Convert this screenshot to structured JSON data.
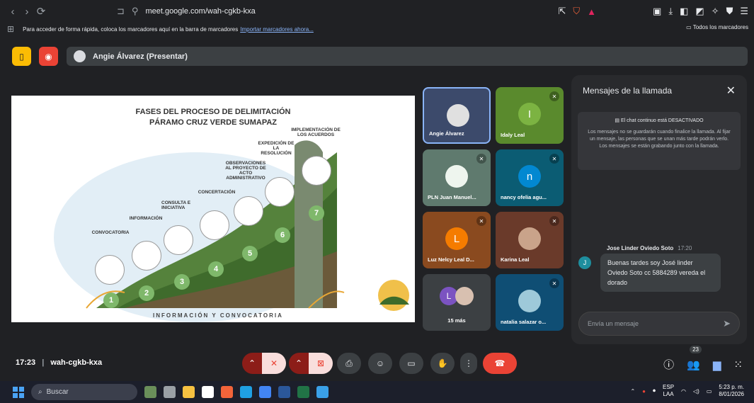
{
  "browser": {
    "url": "meet.google.com/wah-cgkb-kxa",
    "bookmarks_text": "Para acceder de forma rápida, coloca los marcadores aquí en la barra de marcadores",
    "bookmarks_link": "Importar marcadores ahora...",
    "all_bookmarks": "Todos los marcadores"
  },
  "meet": {
    "presenter_label": "Angie Álvarez (Presentar)",
    "meeting_time": "17:23",
    "meeting_code": "wah-cgkb-kxa",
    "participants_count": "23"
  },
  "slide": {
    "title_line1": "FASES DEL PROCESO DE DELIMITACIÓN",
    "title_line2": "PÁRAMO CRUZ VERDE SUMAPAZ",
    "footer": "INFORMACIÓN Y CONVOCATORIA",
    "steps": [
      {
        "num": "1",
        "label": "CONVOCATORIA"
      },
      {
        "num": "2",
        "label": "INFORMACIÓN"
      },
      {
        "num": "3",
        "label": "CONSULTA E INICIATIVA"
      },
      {
        "num": "4",
        "label": "CONCERTACIÓN"
      },
      {
        "num": "5",
        "label": "OBSERVACIONES AL PROYECTO DE ACTO ADMINISTRATIVO"
      },
      {
        "num": "6",
        "label": "EXPEDICIÓN DE LA RESOLUCIÓN"
      },
      {
        "num": "7",
        "label": "IMPLEMENTACIÓN DE LOS ACUERDOS"
      }
    ]
  },
  "participants": [
    {
      "name": "Angie Álvarez",
      "initial": "",
      "color": "#3c4a6b",
      "muted": false
    },
    {
      "name": "Idaly Leal",
      "initial": "I",
      "color": "#5a8a2d",
      "muted": true
    },
    {
      "name": "PLN Juan Manuel...",
      "initial": "",
      "color": "#5f7a6e",
      "muted": true
    },
    {
      "name": "nancy ofelia agu...",
      "initial": "n",
      "color": "#0b5c73",
      "muted": true
    },
    {
      "name": "Luz Nelcy Leal D...",
      "initial": "L",
      "color": "#8a4a1f",
      "muted": true
    },
    {
      "name": "Karina Leal",
      "initial": "",
      "color": "#6a3a2a",
      "muted": true
    },
    {
      "name": "15 más",
      "initial": "L",
      "color": "#3c4043",
      "muted": false
    },
    {
      "name": "natalia salazar o...",
      "initial": "",
      "color": "#0f4e74",
      "muted": true
    }
  ],
  "chat": {
    "title": "Mensajes de la llamada",
    "notice_heading": "El chat continuo está DESACTIVADO",
    "notice_body": "Los mensajes no se guardarán cuando finalice la llamada. Al fijar un mensaje, las personas que se unan más tarde podrán verlo. Los mensajes se están grabando junto con la llamada.",
    "message_author": "Jose Linder Oviedo Soto",
    "message_time": "17:20",
    "message_initial": "J",
    "message_text": "Buenas tardes soy José linder Oviedo Soto cc 5884289 vereda el dorado",
    "input_placeholder": "Envía un mensaje"
  },
  "taskbar": {
    "search_placeholder": "Buscar",
    "lang_top": "ESP",
    "lang_bottom": "LAA",
    "time": "5:23 p. m.",
    "date": "8/01/2026"
  },
  "colors": {
    "accent_blue": "#8ab4f8",
    "end_call_red": "#ea4335",
    "background": "#202124"
  }
}
